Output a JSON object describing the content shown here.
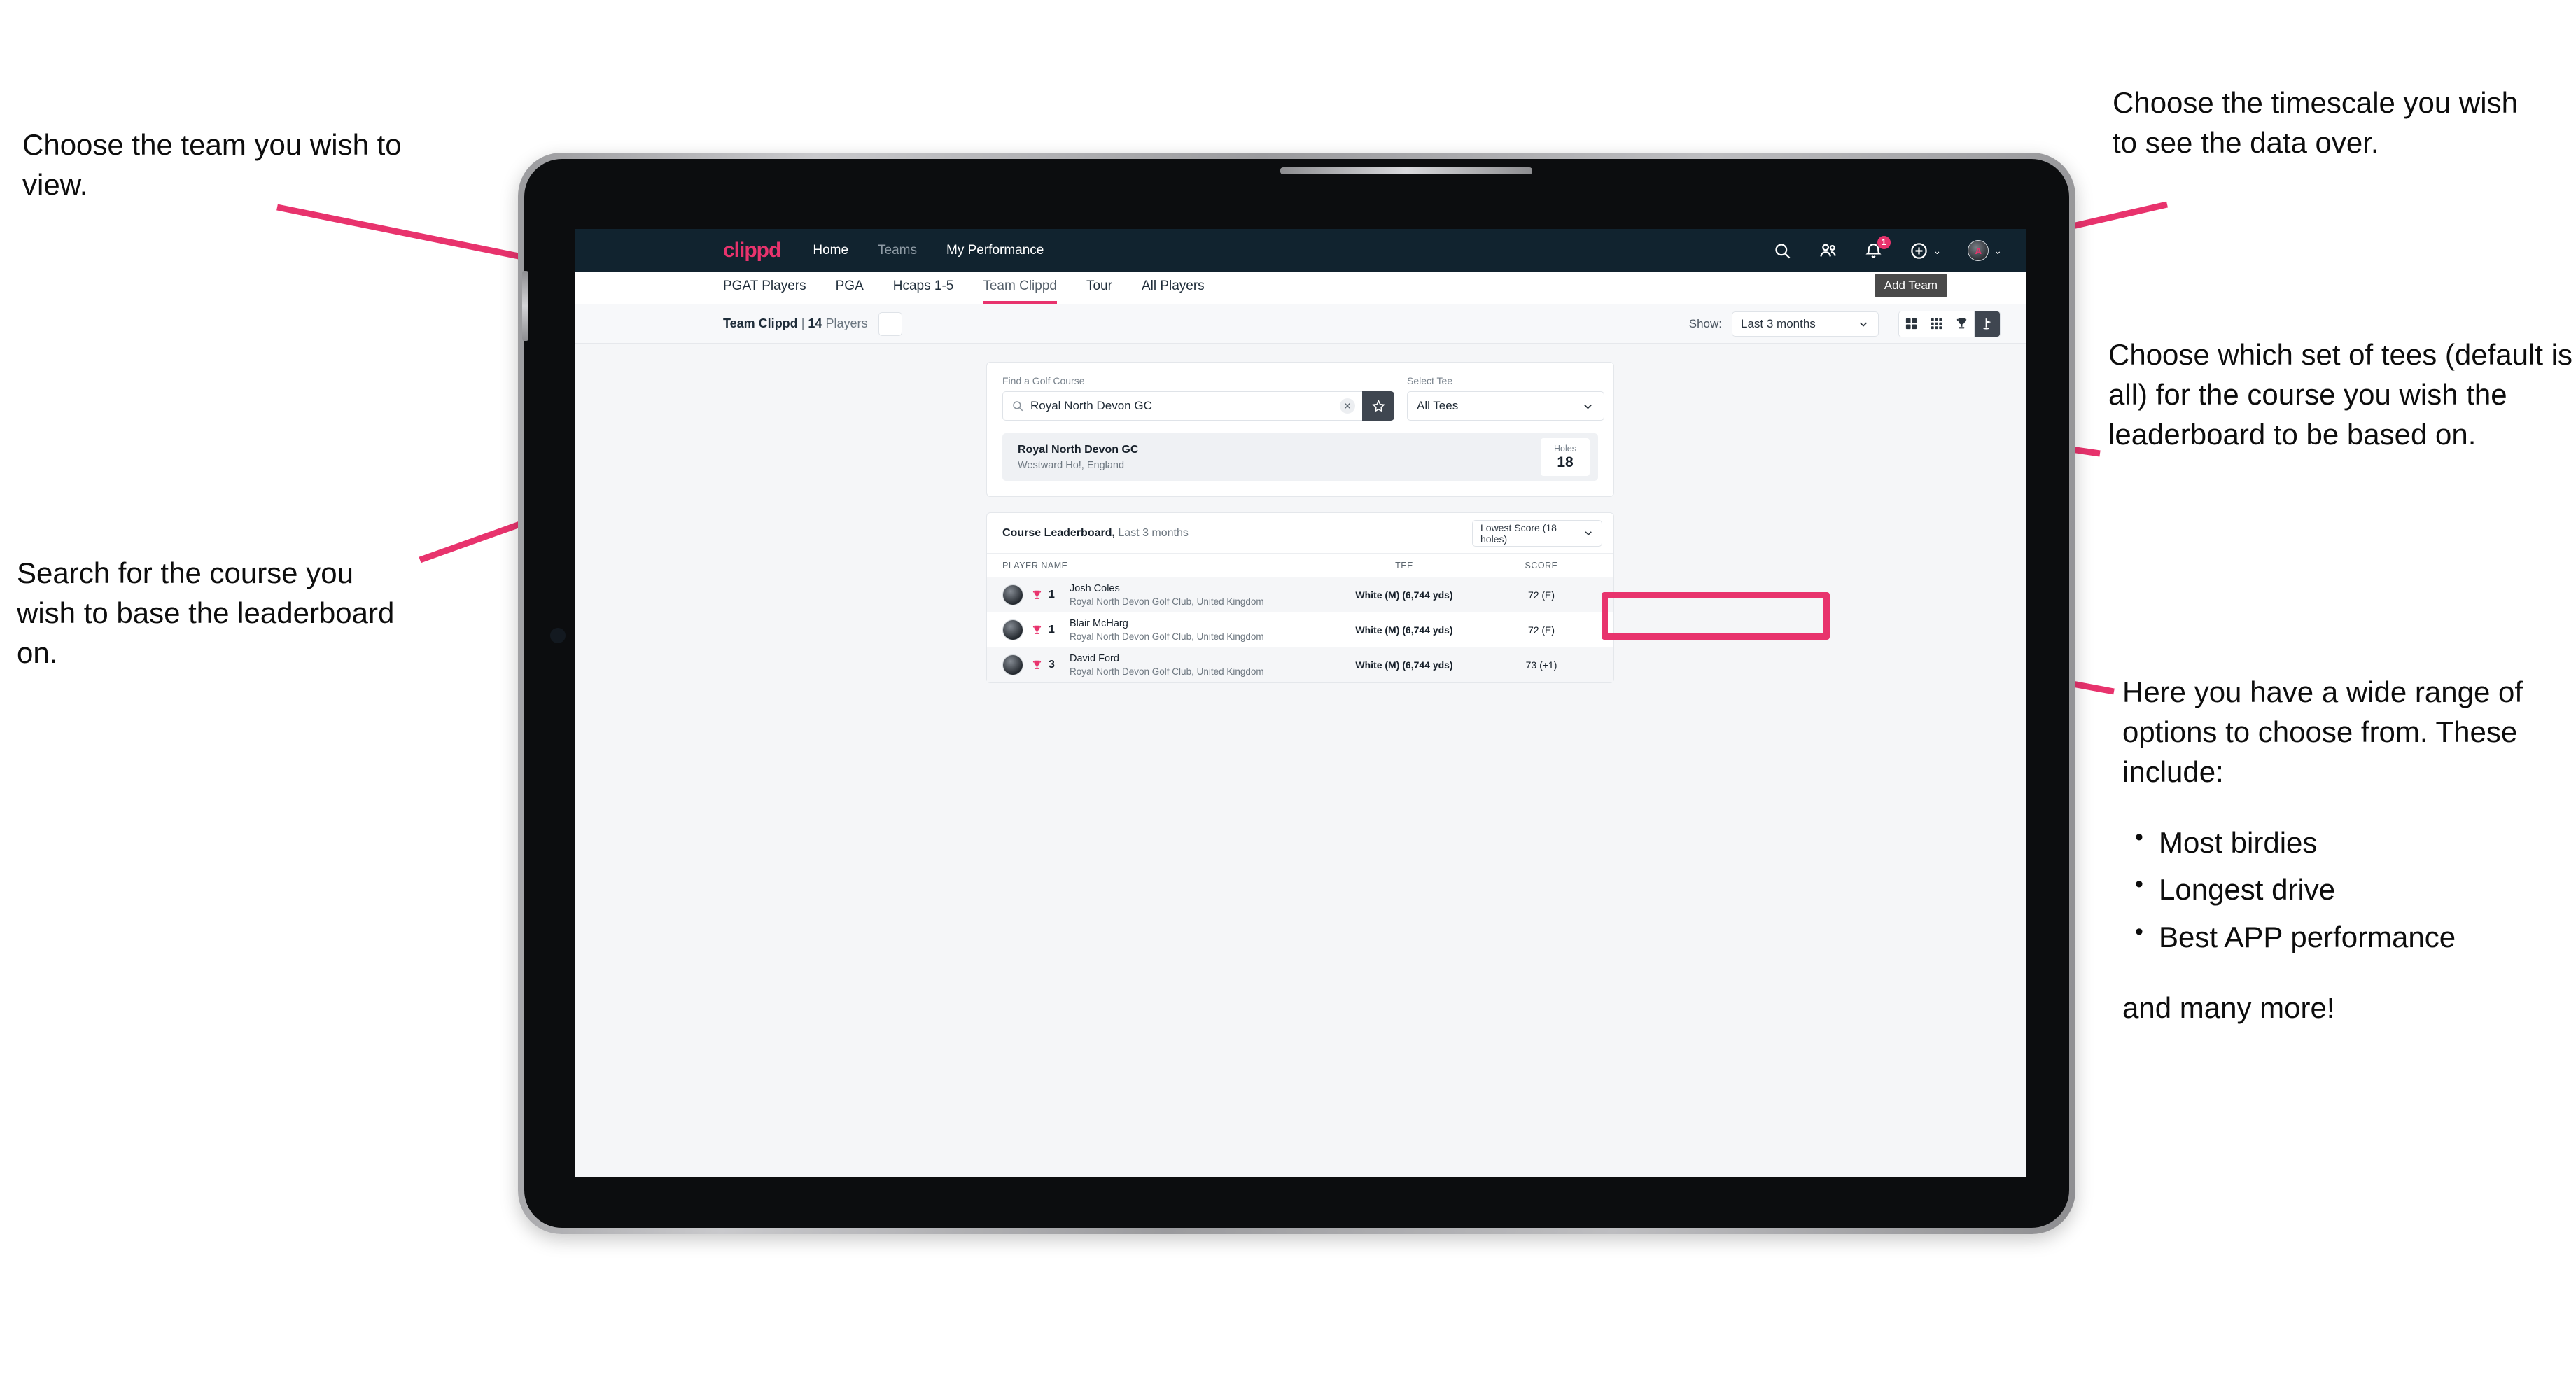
{
  "app": {
    "brand": "clippd",
    "nav": [
      {
        "label": "Home",
        "muted": false
      },
      {
        "label": "Teams",
        "muted": true
      },
      {
        "label": "My Performance",
        "muted": false
      }
    ],
    "notification_count": "1",
    "tooltip": "Add Team",
    "accent_color": "#e8336d",
    "header_bg": "#11232f"
  },
  "tabs": [
    {
      "label": "PGAT Players",
      "active": false
    },
    {
      "label": "PGA",
      "active": false
    },
    {
      "label": "Hcaps 1-5",
      "active": false
    },
    {
      "label": "Team Clippd",
      "active": true
    },
    {
      "label": "Tour",
      "active": false
    },
    {
      "label": "All Players",
      "active": false
    }
  ],
  "toolbar": {
    "team_name": "Team Clippd",
    "separator": "|",
    "player_count": "14",
    "players_word": "Players",
    "show_label": "Show:",
    "timescale_value": "Last 3 months",
    "views": [
      {
        "name": "grid-2x2-view",
        "active": false
      },
      {
        "name": "grid-3x3-view",
        "active": false
      },
      {
        "name": "trophy-view",
        "active": false
      },
      {
        "name": "golf-flag-view",
        "active": true
      }
    ]
  },
  "search_panel": {
    "course_label": "Find a Golf Course",
    "course_value": "Royal North Devon GC",
    "course_placeholder": "Find a Golf Course",
    "tee_label": "Select Tee",
    "tee_value": "All Tees"
  },
  "course_card": {
    "name": "Royal North Devon GC",
    "location": "Westward Ho!, England",
    "holes_label": "Holes",
    "holes_value": "18"
  },
  "leaderboard": {
    "title": "Course Leaderboard,",
    "subtitle": " Last 3 months",
    "sort_value": "Lowest Score (18 holes)",
    "columns": {
      "player": "PLAYER NAME",
      "tee": "TEE",
      "score": "SCORE"
    },
    "rows": [
      {
        "rank": "1",
        "name": "Josh Coles",
        "club": "Royal North Devon Golf Club, United Kingdom",
        "tee": "White (M) (6,744 yds)",
        "score": "72 (E)"
      },
      {
        "rank": "1",
        "name": "Blair McHarg",
        "club": "Royal North Devon Golf Club, United Kingdom",
        "tee": "White (M) (6,744 yds)",
        "score": "72 (E)"
      },
      {
        "rank": "3",
        "name": "David Ford",
        "club": "Royal North Devon Golf Club, United Kingdom",
        "tee": "White (M) (6,744 yds)",
        "score": "73 (+1)"
      }
    ]
  },
  "annotations": {
    "team": "Choose the team you wish to view.",
    "search": "Search for the course you wish to base the leaderboard on.",
    "timescale": "Choose the timescale you wish to see the data over.",
    "tees": "Choose which set of tees (default is all) for the course you wish the leaderboard to be based on.",
    "options_intro": "Here you have a wide range of options to choose from. These include:",
    "options_list": [
      "Most birdies",
      "Longest drive",
      "Best APP performance"
    ],
    "options_tail": "and many more!"
  }
}
